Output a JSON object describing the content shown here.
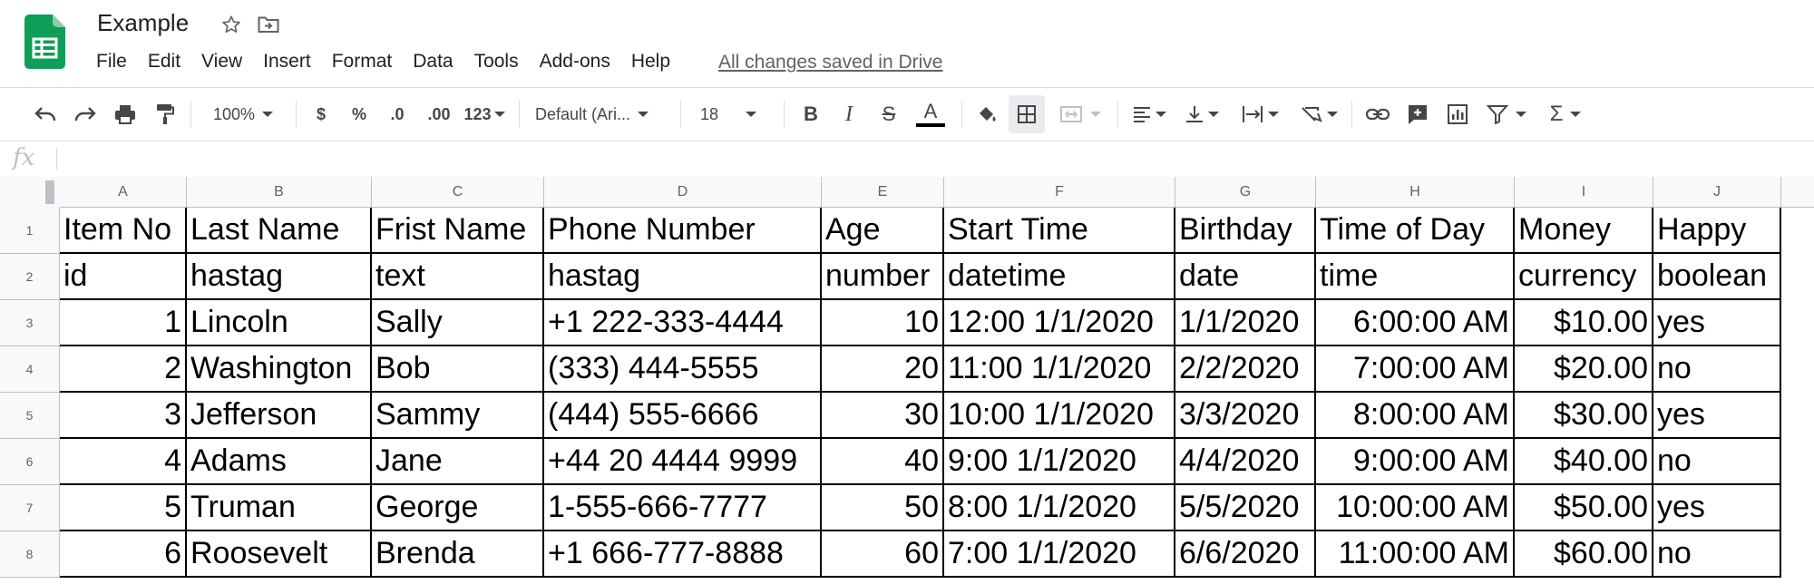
{
  "doc": {
    "title": "Example",
    "save_status": "All changes saved in Drive"
  },
  "menu": [
    "File",
    "Edit",
    "View",
    "Insert",
    "Format",
    "Data",
    "Tools",
    "Add-ons",
    "Help"
  ],
  "toolbar": {
    "zoom": "100%",
    "currency": "$",
    "percent": "%",
    "decrease_decimal": ".0",
    "increase_decimal": ".00",
    "more_formats": "123",
    "font": "Default (Ari...",
    "font_size": "18",
    "bold": "B",
    "italic": "I",
    "strikethrough": "S",
    "text_color_glyph": "A",
    "sum": "Σ"
  },
  "formula_bar": {
    "fx": "fx",
    "value": ""
  },
  "columns": [
    "A",
    "B",
    "C",
    "D",
    "E",
    "F",
    "G",
    "H",
    "I",
    "J"
  ],
  "rows": [
    "1",
    "2",
    "3",
    "4",
    "5",
    "6",
    "7",
    "8"
  ],
  "cells": [
    [
      "Item No",
      "Last Name",
      "Frist Name",
      "Phone Number",
      "Age",
      "Start Time",
      "Birthday",
      "Time of Day",
      "Money",
      "Happy"
    ],
    [
      "id",
      "hastag",
      "text",
      "hastag",
      "number",
      "datetime",
      "date",
      "time",
      "currency",
      "boolean"
    ],
    [
      "1",
      "Lincoln",
      "Sally",
      "+1 222-333-4444",
      "10",
      "12:00 1/1/2020",
      "1/1/2020",
      "6:00:00 AM",
      "$10.00",
      "yes"
    ],
    [
      "2",
      "Washington",
      "Bob",
      "(333) 444-5555",
      "20",
      "11:00 1/1/2020",
      "2/2/2020",
      "7:00:00 AM",
      "$20.00",
      "no"
    ],
    [
      "3",
      "Jefferson",
      "Sammy",
      "(444) 555-6666",
      "30",
      "10:00 1/1/2020",
      "3/3/2020",
      "8:00:00 AM",
      "$30.00",
      "yes"
    ],
    [
      "4",
      "Adams",
      "Jane",
      "+44 20 4444 9999",
      "40",
      "9:00 1/1/2020",
      "4/4/2020",
      "9:00:00 AM",
      "$40.00",
      "no"
    ],
    [
      "5",
      "Truman",
      "George",
      "1-555-666-7777",
      "50",
      "8:00 1/1/2020",
      "5/5/2020",
      "10:00:00 AM",
      "$50.00",
      "yes"
    ],
    [
      "6",
      "Roosevelt",
      "Brenda",
      "+1 666-777-8888",
      "60",
      "7:00 1/1/2020",
      "6/6/2020",
      "11:00:00 AM",
      "$60.00",
      "no"
    ]
  ],
  "icons": {
    "app_logo": "sheets-logo-icon",
    "star": "star-icon",
    "move": "move-to-folder-icon"
  },
  "colors": {
    "sheets_green": "#0f9d58",
    "header_bg": "#f8f9fa",
    "link_gray": "#5f6368"
  }
}
